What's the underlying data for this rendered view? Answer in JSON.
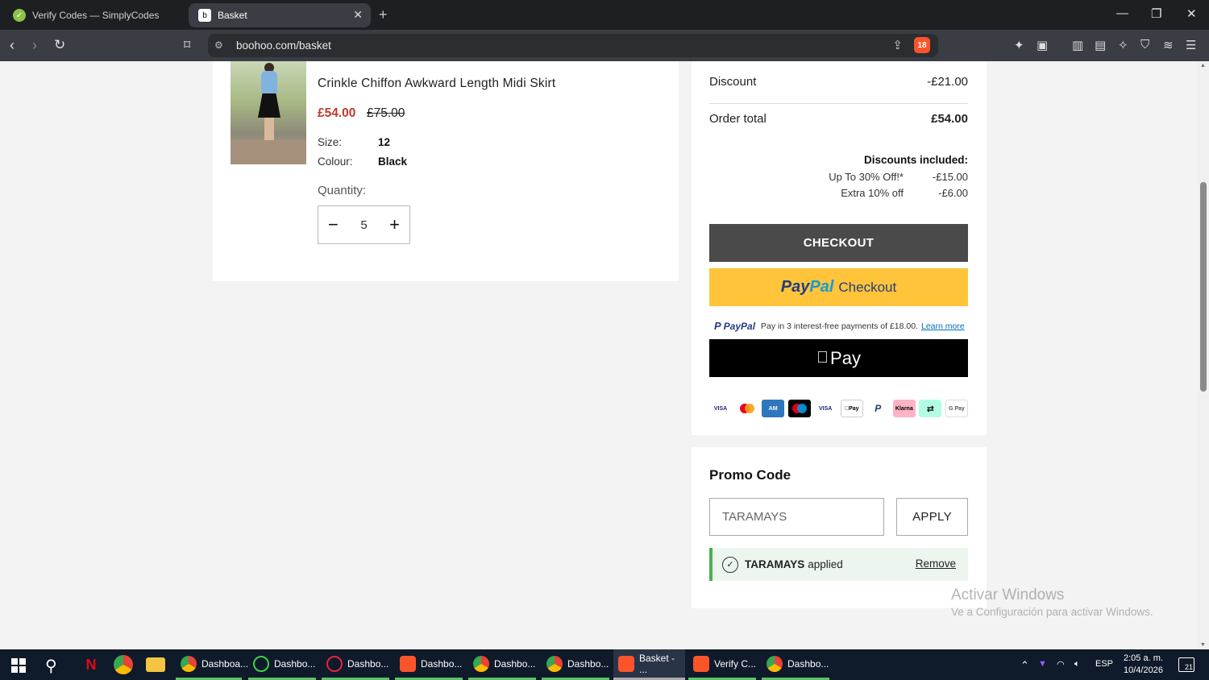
{
  "browser": {
    "tabs": [
      {
        "title": "Verify Codes — SimplyCodes",
        "active": false
      },
      {
        "title": "Basket",
        "active": true
      }
    ],
    "url": "boohoo.com/basket",
    "brave_badge": "18"
  },
  "product": {
    "title": "Crinkle Chiffon Awkward Length Midi Skirt",
    "price_now": "£54.00",
    "price_was": "£75.00",
    "size_label": "Size:",
    "size_value": "12",
    "colour_label": "Colour:",
    "colour_value": "Black",
    "quantity_label": "Quantity:",
    "quantity_value": "5"
  },
  "summary": {
    "discount_label": "Discount",
    "discount_value": "-£21.00",
    "order_total_label": "Order total",
    "order_total_value": "£54.00",
    "discounts_included_title": "Discounts included:",
    "discounts": [
      {
        "name": "Up To 30% Off!*",
        "amount": "-£15.00"
      },
      {
        "name": "Extra 10% off",
        "amount": "-£6.00"
      }
    ],
    "checkout_label": "CHECKOUT",
    "paypal_pay": "Pay",
    "paypal_pal": "Pal",
    "paypal_checkout": "Checkout",
    "paylater_brand": "PayPal",
    "paylater_text": "Pay in 3 interest-free payments of £18.00.",
    "paylater_link": "Learn more",
    "applepay_label": "Pay",
    "payment_methods": [
      "VISA",
      "Mastercard",
      "Amex",
      "Maestro",
      "VISA",
      "Apple Pay",
      "PayPal",
      "Klarna",
      "Clearpay",
      "G Pay"
    ]
  },
  "promo": {
    "title": "Promo Code",
    "input_value": "TARAMAYS",
    "apply_label": "APPLY",
    "applied_code": "TARAMAYS",
    "applied_text": "applied",
    "remove_label": "Remove"
  },
  "watermark": {
    "line1": "Activar Windows",
    "line2": "Ve a Configuración para activar Windows."
  },
  "taskbar": {
    "items": [
      "Dashboa...",
      "Dashbo...",
      "Dashbo...",
      "Dashbo...",
      "Dashbo...",
      "Dashbo...",
      "Basket - ...",
      "Verify C...",
      "Dashbo..."
    ],
    "language": "ESP",
    "time": "2:05 a. m.",
    "date": "10/4/2026",
    "notifications": "21"
  }
}
